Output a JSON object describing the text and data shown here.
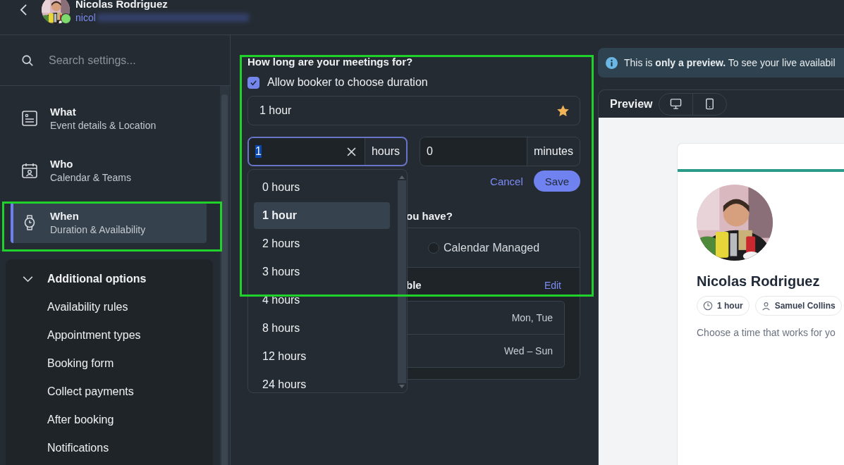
{
  "header": {
    "name": "Nicolas Rodriguez",
    "email": "nicol",
    "online": true
  },
  "search": {
    "placeholder": "Search settings..."
  },
  "nav": [
    {
      "title": "What",
      "subtitle": "Event details & Location",
      "kind": "document",
      "selected": false
    },
    {
      "title": "Who",
      "subtitle": "Calendar & Teams",
      "kind": "calendar",
      "selected": false
    },
    {
      "title": "When",
      "subtitle": "Duration & Availability",
      "kind": "watch",
      "selected": true
    }
  ],
  "additional_options": {
    "title": "Additional options",
    "expanded": true,
    "items": [
      "Availability rules",
      "Appointment types",
      "Booking form",
      "Collect payments",
      "After booking",
      "Notifications"
    ]
  },
  "duration": {
    "title": "How long are your meetings for?",
    "allow_choice": {
      "label": "Allow booker to choose duration",
      "checked": true
    },
    "chosen": "1 hour",
    "starred": true,
    "hours_value": "1",
    "hours_unit": "hours",
    "minutes_value": "0",
    "minutes_unit": "minutes",
    "cancel": "Cancel",
    "save": "Save",
    "options": [
      {
        "label": "0 hours",
        "selected": false
      },
      {
        "label": "1 hour",
        "selected": true
      },
      {
        "label": "2 hours",
        "selected": false
      },
      {
        "label": "3 hours",
        "selected": false
      },
      {
        "label": "4 hours",
        "selected": false
      },
      {
        "label": "8 hours",
        "selected": false
      },
      {
        "label": "12 hours",
        "selected": false
      },
      {
        "label": "24 hours",
        "selected": false
      }
    ]
  },
  "availability": {
    "title": "ou have?",
    "radio": {
      "label": "Calendar Managed",
      "selected": false
    },
    "schedule_title": "ble",
    "edit": "Edit",
    "rows": [
      "Mon, Tue",
      "Wed – Sun"
    ]
  },
  "banner": {
    "text": "This is **only a preview.** To see your live availabil"
  },
  "preview": {
    "title": "Preview",
    "devices": [
      {
        "kind": "desktop"
      },
      {
        "kind": "mobile"
      }
    ],
    "card": {
      "name": "Nicolas Rodriguez",
      "chips": [
        {
          "kind": "duration",
          "label": "1 hour"
        },
        {
          "kind": "host",
          "label": "Samuel Collins"
        }
      ],
      "prompt": "Choose a time that works for yo"
    }
  }
}
